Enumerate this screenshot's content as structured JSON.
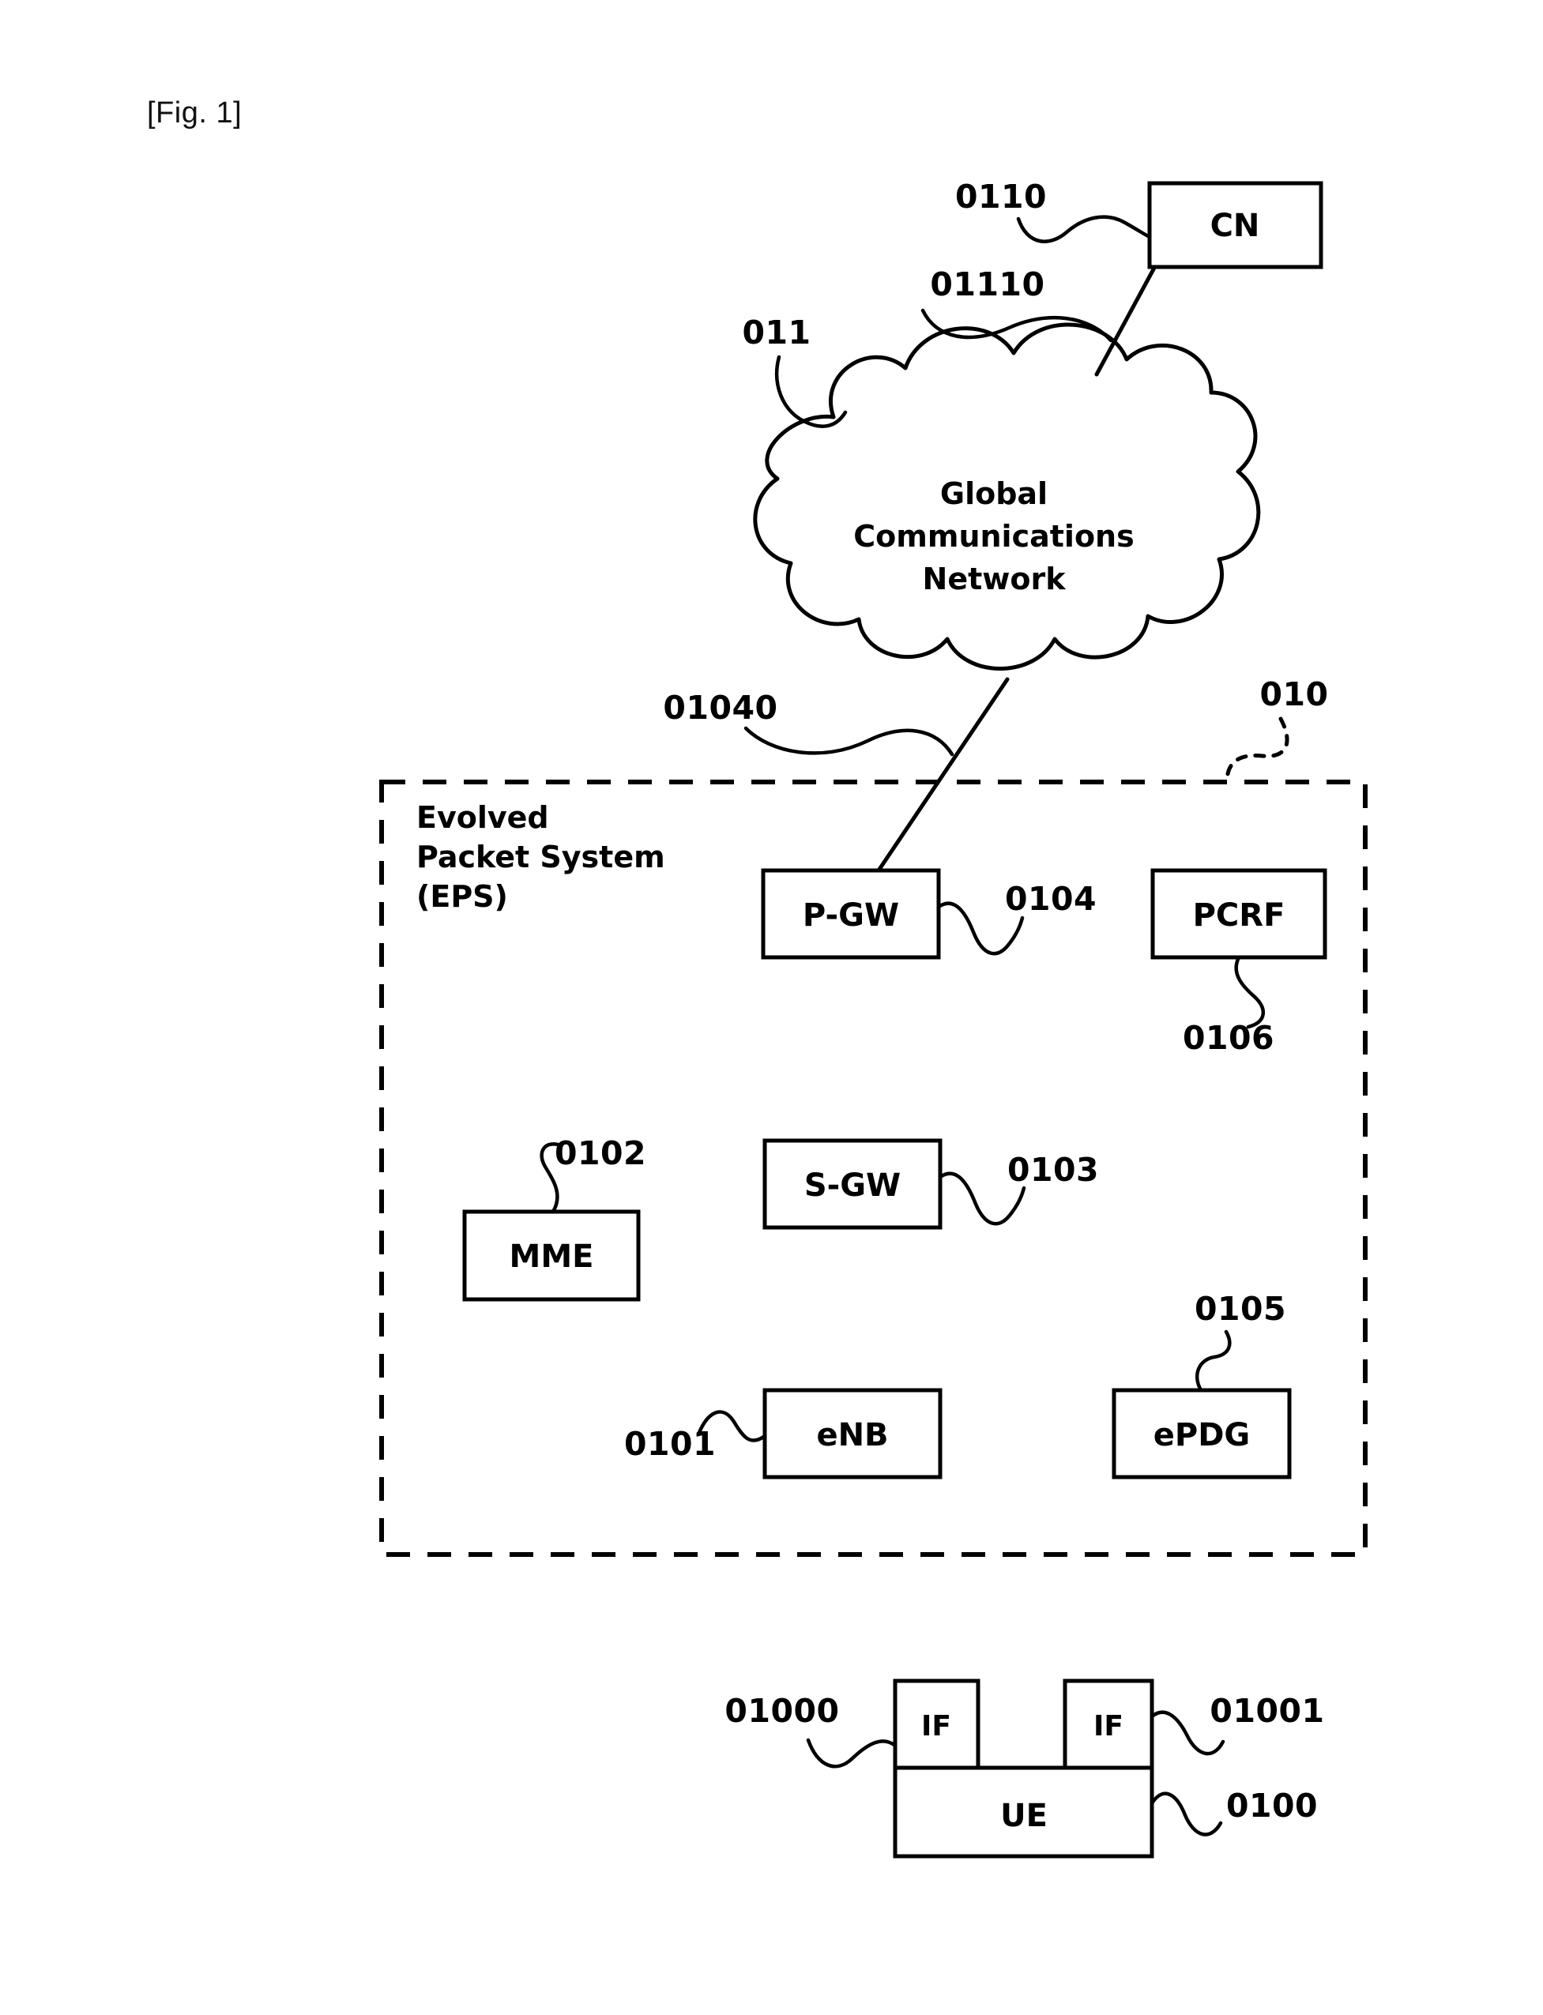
{
  "figure": {
    "label": "[Fig. 1]"
  },
  "cloud": {
    "id": "global-communications-network",
    "lines": [
      "Global",
      "Communications",
      "Network"
    ],
    "ref": "011"
  },
  "cn": {
    "label": "CN",
    "ref": "0110"
  },
  "links": {
    "cn_to_cloud_ref": "01110",
    "cloud_to_pgw_ref": "01040"
  },
  "eps": {
    "ref": "010",
    "title_lines": [
      "Evolved",
      "Packet System",
      "(EPS)"
    ],
    "nodes": [
      {
        "key": "pgw",
        "label": "P-GW",
        "ref": "0104"
      },
      {
        "key": "pcrf",
        "label": "PCRF",
        "ref": "0106"
      },
      {
        "key": "sgw",
        "label": "S-GW",
        "ref": "0103"
      },
      {
        "key": "mme",
        "label": "MME",
        "ref": "0102"
      },
      {
        "key": "enb",
        "label": "eNB",
        "ref": "0101"
      },
      {
        "key": "epdg",
        "label": "ePDG",
        "ref": "0105"
      }
    ]
  },
  "ue": {
    "label": "UE",
    "ref": "0100",
    "interfaces": [
      {
        "key": "if-left",
        "label": "IF",
        "ref": "01000"
      },
      {
        "key": "if-right",
        "label": "IF",
        "ref": "01001"
      }
    ]
  },
  "colors": {
    "ink": "#000000",
    "paper": "#ffffff"
  }
}
